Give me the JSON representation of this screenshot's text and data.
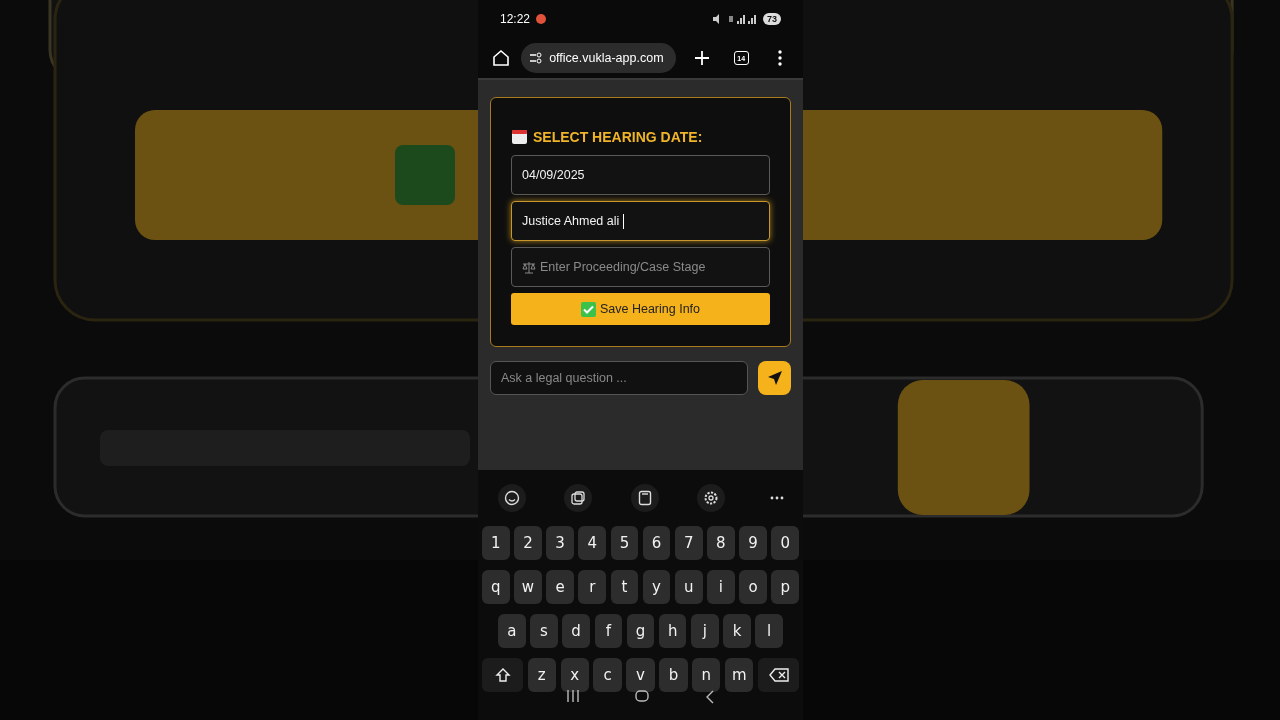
{
  "status_bar": {
    "time": "12:22",
    "battery": "73"
  },
  "browser": {
    "url": "office.vukla-app.com",
    "tab_count": "14"
  },
  "hearing_card": {
    "title": "SELECT HEARING DATE:",
    "fields": [
      {
        "kind": "value",
        "text": "04/09/2025",
        "focused": false
      },
      {
        "kind": "value",
        "text": "Justice Ahmed ali",
        "focused": true
      },
      {
        "kind": "placeholder",
        "text": "Enter Proceeding/Case Stage",
        "focused": false
      }
    ],
    "save_button": "Save Hearing Info"
  },
  "chat": {
    "placeholder": "Ask a legal question ..."
  },
  "keyboard": {
    "rows": [
      [
        {
          "kind": "char",
          "label": "1"
        },
        {
          "kind": "char",
          "label": "2"
        },
        {
          "kind": "char",
          "label": "3"
        },
        {
          "kind": "char",
          "label": "4"
        },
        {
          "kind": "char",
          "label": "5"
        },
        {
          "kind": "char",
          "label": "6"
        },
        {
          "kind": "char",
          "label": "7"
        },
        {
          "kind": "char",
          "label": "8"
        },
        {
          "kind": "char",
          "label": "9"
        },
        {
          "kind": "char",
          "label": "0"
        }
      ],
      [
        {
          "kind": "char",
          "label": "q"
        },
        {
          "kind": "char",
          "label": "w"
        },
        {
          "kind": "char",
          "label": "e"
        },
        {
          "kind": "char",
          "label": "r"
        },
        {
          "kind": "char",
          "label": "t"
        },
        {
          "kind": "char",
          "label": "y"
        },
        {
          "kind": "char",
          "label": "u"
        },
        {
          "kind": "char",
          "label": "i"
        },
        {
          "kind": "char",
          "label": "o"
        },
        {
          "kind": "char",
          "label": "p"
        }
      ],
      [
        {
          "kind": "char",
          "label": "a"
        },
        {
          "kind": "char",
          "label": "s"
        },
        {
          "kind": "char",
          "label": "d"
        },
        {
          "kind": "char",
          "label": "f"
        },
        {
          "kind": "char",
          "label": "g"
        },
        {
          "kind": "char",
          "label": "h"
        },
        {
          "kind": "char",
          "label": "j"
        },
        {
          "kind": "char",
          "label": "k"
        },
        {
          "kind": "char",
          "label": "l"
        }
      ],
      [
        {
          "kind": "shift"
        },
        {
          "kind": "char",
          "label": "z"
        },
        {
          "kind": "char",
          "label": "x"
        },
        {
          "kind": "char",
          "label": "c"
        },
        {
          "kind": "char",
          "label": "v"
        },
        {
          "kind": "char",
          "label": "b"
        },
        {
          "kind": "char",
          "label": "n"
        },
        {
          "kind": "char",
          "label": "m"
        },
        {
          "kind": "backspace"
        }
      ]
    ]
  }
}
